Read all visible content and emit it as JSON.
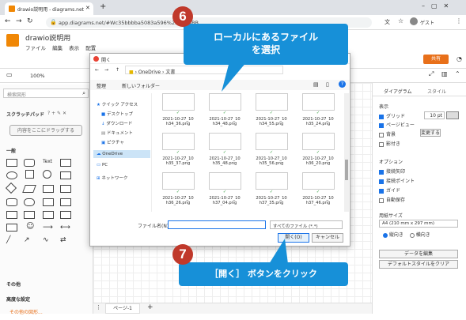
{
  "browser": {
    "tab_title": "drawio説明用 - diagrams.net",
    "url": "app.diagrams.net/#Wc35bbbba5083a596%2FC35BBB",
    "guest": "ゲスト"
  },
  "app": {
    "title": "drawio説明用",
    "menus": [
      "ファイル",
      "編集",
      "表示",
      "配置"
    ],
    "zoom": "100%",
    "share": "共有"
  },
  "left": {
    "search": "検索図形",
    "scratchpad": "スクラッチパッド",
    "scratch_actions": "? + ✎ ✕",
    "drop_here": "内容をここにドラッグする",
    "general": "一般",
    "others": "その他",
    "advanced": "高度な設定",
    "more_shapes": "その他の図形..."
  },
  "dialog": {
    "title": "開く",
    "path_onedrive": "OneDrive",
    "path_docs": "文書",
    "organize": "整理",
    "new_folder": "新しいフォルダー",
    "nav": [
      "クイック アクセス",
      "デスクトップ",
      "ダウンロード",
      "ドキュメント",
      "ピクチャ",
      "OneDrive",
      "PC",
      "ネットワーク"
    ],
    "files": [
      {
        "d": "2021-10-27_10",
        "n": "h34_36.png"
      },
      {
        "d": "2021-10-27_10",
        "n": "h34_48.png"
      },
      {
        "d": "2021-10-27_10",
        "n": "h34_55.png"
      },
      {
        "d": "2021-10-27_10",
        "n": "h35_24.png"
      },
      {
        "d": "2021-10-27_10",
        "n": "h35_37.png"
      },
      {
        "d": "2021-10-27_10",
        "n": "h35_48.png"
      },
      {
        "d": "2021-10-27_10",
        "n": "h35_56.png"
      },
      {
        "d": "2021-10-27_10",
        "n": "h36_20.png"
      },
      {
        "d": "2021-10-27_10",
        "n": "h36_26.png"
      },
      {
        "d": "2021-10-27_10",
        "n": "h37_04.png"
      },
      {
        "d": "2021-10-27_10",
        "n": "h37_35.png"
      },
      {
        "d": "2021-10-27_10",
        "n": "h37_46.png"
      }
    ],
    "filename_label": "ファイル名(N):",
    "filetype": "すべてのファイル (*.*)",
    "open": "開く(O)",
    "cancel": "キャンセル"
  },
  "right": {
    "tab_diagram": "ダイアグラム",
    "tab_style": "スタイル",
    "view": "表示",
    "grid": "グリッド",
    "grid_size": "10 pt",
    "page_view": "ページビュー",
    "background": "背景",
    "change": "変更する",
    "shadow": "影付き",
    "options": "オプション",
    "connection_arrows": "接続矢印",
    "connection_points": "接続ポイント",
    "guides": "ガイド",
    "autosave": "自動保存",
    "paper_size": "用紙サイズ",
    "paper": "A4 (210 mm x 297 mm)",
    "portrait": "縦向き",
    "landscape": "横向き",
    "edit_data": "データを編集",
    "clear_style": "デフォルトスタイルをクリア"
  },
  "footer": {
    "page": "ページ-1"
  },
  "annotations": {
    "step6_num": "6",
    "step6_text1": "ローカルにあるファイル",
    "step6_text2": "を選択",
    "step7_num": "7",
    "step7_text": "［開く］ ボタンをクリック"
  },
  "colors": {
    "callout": "#1790d8",
    "badge": "#c0392b",
    "share": "#e8701a"
  }
}
